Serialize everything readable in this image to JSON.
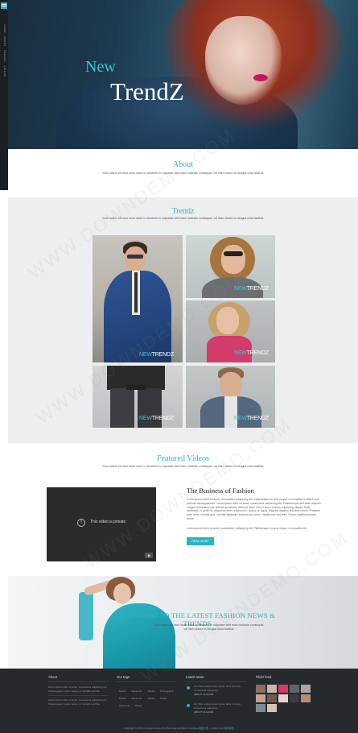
{
  "hero": {
    "title_small": "New",
    "title_large": "TrendZ",
    "menu_icon": "hamburger-menu-icon",
    "vertical_text": "HOME · ABOUT · TRENDZ · VIDEOS"
  },
  "about": {
    "title": "About",
    "text": "Duis autem vel eum iriure dolor in hendrerit in vulputate velit esse molestie consequat, vel illum dolore eu feugiat nulla facilisis."
  },
  "trendz": {
    "title": "Trendz",
    "text": "Duis autem vel eum iriure dolor in hendrerit in vulputate velit esse molestie consequat, vel illum dolore eu feugiat nulla facilisis.",
    "tag_new": "NEW",
    "tag_trendz": "TRENDZ"
  },
  "videos": {
    "title": "Featured Videos",
    "text": "Duis autem vel eum iriure dolor in hendrerit in vulputate velit esse molestie consequat, vel illum dolore eu feugiat nulla facilisis.",
    "player_message": "This video is private",
    "player_icon": "info-icon",
    "yt_icon": "youtube-icon",
    "article_title": "The Business of Fashion",
    "article_p1": "Lorem ipsum dolor sit amet, consectetur adipiscing elit. Pellentesque in arcu neque, ut convallis est Mia Fusce pulvinar consequat nisl. Lorem ipsum dolor sit amet, consectetur adipiscing elit. Pellentesque sed diam aliquam congue fermentum nisi. Mauris accumsan nulla vel diam. Sed in lacus ut enim adipiscing aliquet. Nulla venenatis. In pede mi, aliquet sit amet, euismod in, auctor ut, ligula. Aliquam dapibus tincidunt metus. Praesent justo dolor, lobortis quis, lobortis dignissim, pulvinar ac, lorem. Vestibulum sed ante. Donec sagittis euismod purus.",
    "article_p2": "Lorem ipsum dolor sit amet, consectetur adipiscing elit. Pellentesque in arcu neque, ut convallis est.",
    "read_more": "READ MORE"
  },
  "banner": {
    "title": "SUBSCRIBE TO THE LATEST FASHION NEWS & TRENDS",
    "text": "Duis autem vel eum iriure dolor in hendrerit in vulputate velit esse molestie consequat, vel illum dolore eu feugiat nulla facilisis."
  },
  "footer": {
    "col1_title": "About",
    "col1_text1": "Lorem ipsum dolor sit amet, consectetur adipiscing elit. Pellentesque in arcu neque, ut convallis est Mia.",
    "col1_text2": "Lorem ipsum dolor sit amet, consectetur adipiscing elit. Pellentesque in arcu neque, ut convallis est Mia.",
    "col2_title": "Our tags",
    "tags": [
      "Model",
      "Awesome",
      "Model",
      "Photography",
      "Model",
      "Awesome",
      "Model",
      "Model",
      "Awesome",
      "Model"
    ],
    "col3_title": "Latest news",
    "news1_text": "Our Nice Latest Lorem ipsum dolor sit amet, consectetur adipiscing",
    "news1_meta": "ABOUT 10 HOUR",
    "news2_text": "Our Nice Latest Lorem ipsum dolor sit amet, consectetur adipiscing",
    "news2_meta": "ABOUT 10 HOUR",
    "col4_title": "Flickr feed",
    "copyright_pre": "Copyright © 2016 Company name All rights reserved.More Templates",
    "copyright_link1": "模板之家",
    "copyright_mid": " - Collect from",
    "copyright_link2": "网页模板"
  },
  "watermark": "WWW.DOWNDEMO.COM",
  "colors": {
    "accent": "#29b6c1",
    "footer_bg": "#262a2d",
    "section_grey": "#eceeef"
  }
}
